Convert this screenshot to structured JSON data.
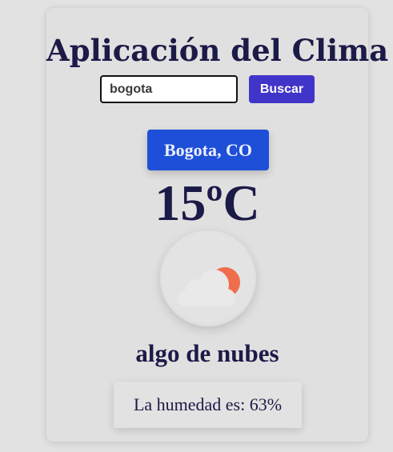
{
  "app": {
    "title": "Aplicación del Clima"
  },
  "search": {
    "value": "bogota",
    "button_label": "Buscar"
  },
  "weather": {
    "city": "Bogota, CO",
    "temperature": "15ºC",
    "icon": "few-clouds-icon",
    "description": "algo de nubes",
    "humidity_text": "La humedad es: 63%"
  },
  "colors": {
    "background": "#e2e2e2",
    "text": "#1c1a47",
    "button": "#4134c8",
    "city_badge": "#1d4fd8",
    "sun": "#ef6d4c",
    "cloud": "#e9e9e9"
  }
}
